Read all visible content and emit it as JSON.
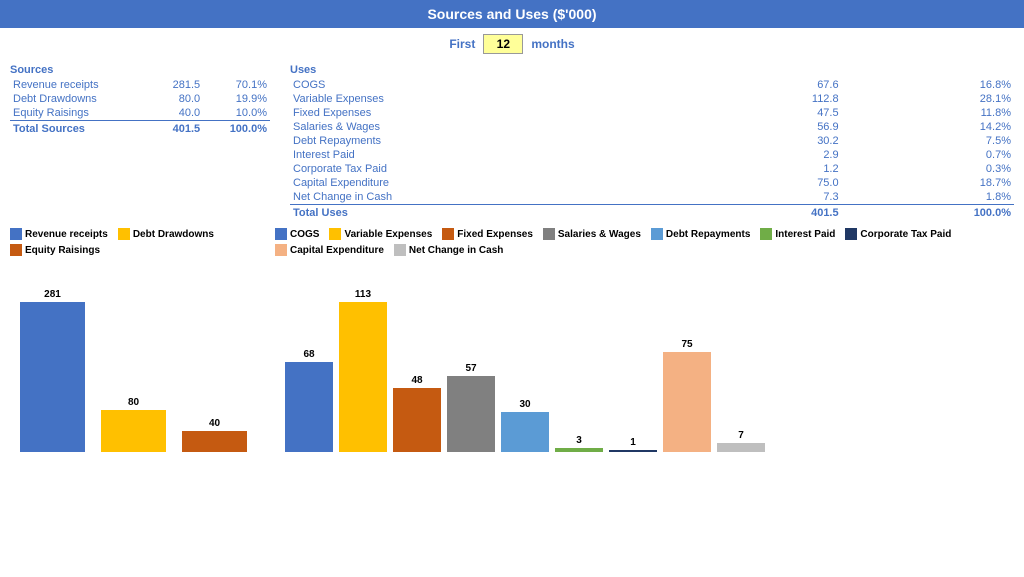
{
  "header": {
    "title": "Sources and Uses ($'000)"
  },
  "months_row": {
    "first_label": "First",
    "months_value": "12",
    "months_label": "months"
  },
  "sources": {
    "title": "Sources",
    "rows": [
      {
        "label": "Revenue receipts",
        "value": "281.5",
        "pct": "70.1%"
      },
      {
        "label": "Debt Drawdowns",
        "value": "80.0",
        "pct": "19.9%"
      },
      {
        "label": "Equity Raisings",
        "value": "40.0",
        "pct": "10.0%"
      }
    ],
    "total_label": "Total Sources",
    "total_value": "401.5",
    "total_pct": "100.0%"
  },
  "uses": {
    "title": "Uses",
    "rows": [
      {
        "label": "COGS",
        "value": "67.6",
        "pct": "16.8%"
      },
      {
        "label": "Variable Expenses",
        "value": "112.8",
        "pct": "28.1%"
      },
      {
        "label": "Fixed Expenses",
        "value": "47.5",
        "pct": "11.8%"
      },
      {
        "label": "Salaries & Wages",
        "value": "56.9",
        "pct": "14.2%"
      },
      {
        "label": "Debt Repayments",
        "value": "30.2",
        "pct": "7.5%"
      },
      {
        "label": "Interest Paid",
        "value": "2.9",
        "pct": "0.7%"
      },
      {
        "label": "Corporate Tax Paid",
        "value": "1.2",
        "pct": "0.3%"
      },
      {
        "label": "Capital Expenditure",
        "value": "75.0",
        "pct": "18.7%"
      },
      {
        "label": "Net Change in Cash",
        "value": "7.3",
        "pct": "1.8%"
      }
    ],
    "total_label": "Total Uses",
    "total_value": "401.5",
    "total_pct": "100.0%"
  },
  "sources_chart": {
    "legend": [
      {
        "label": "Revenue receipts",
        "color": "blue"
      },
      {
        "label": "Debt Drawdowns",
        "color": "yellow"
      },
      {
        "label": "Equity Raisings",
        "color": "orange"
      }
    ],
    "bars": [
      {
        "label": "Revenue receipts",
        "value": 281,
        "color": "blue",
        "height": 150
      },
      {
        "label": "Debt Drawdowns",
        "value": 80,
        "color": "yellow",
        "height": 42
      },
      {
        "label": "Equity Raisings",
        "value": 40,
        "color": "orange",
        "height": 21
      }
    ]
  },
  "uses_chart": {
    "legend": [
      {
        "label": "COGS",
        "color": "blue"
      },
      {
        "label": "Variable Expenses",
        "color": "yellow"
      },
      {
        "label": "Fixed Expenses",
        "color": "orange"
      },
      {
        "label": "Salaries & Wages",
        "color": "gray"
      },
      {
        "label": "Debt Repayments",
        "color": "lightblue"
      },
      {
        "label": "Interest Paid",
        "color": "green"
      },
      {
        "label": "Corporate Tax Paid",
        "color": "darkblue"
      },
      {
        "label": "Capital Expenditure",
        "color": "salmon"
      },
      {
        "label": "Net Change in Cash",
        "color": "lightgray"
      }
    ],
    "bars": [
      {
        "label": "COGS",
        "value": 68,
        "color": "blue",
        "height": 90
      },
      {
        "label": "Variable Expenses",
        "value": 113,
        "color": "yellow",
        "height": 150
      },
      {
        "label": "Fixed Expenses",
        "value": 48,
        "color": "orange",
        "height": 64
      },
      {
        "label": "Salaries & Wages",
        "value": 57,
        "color": "gray",
        "height": 76
      },
      {
        "label": "Debt Repayments",
        "value": 30,
        "color": "lightblue",
        "height": 40
      },
      {
        "label": "Interest Paid",
        "value": 3,
        "color": "green",
        "height": 4
      },
      {
        "label": "Corporate Tax Paid",
        "value": 1,
        "color": "darkblue",
        "height": 2
      },
      {
        "label": "Capital Expenditure",
        "value": 75,
        "color": "salmon",
        "height": 100
      },
      {
        "label": "Net Change in Cash",
        "value": 7,
        "color": "lightgray",
        "height": 9
      }
    ]
  }
}
